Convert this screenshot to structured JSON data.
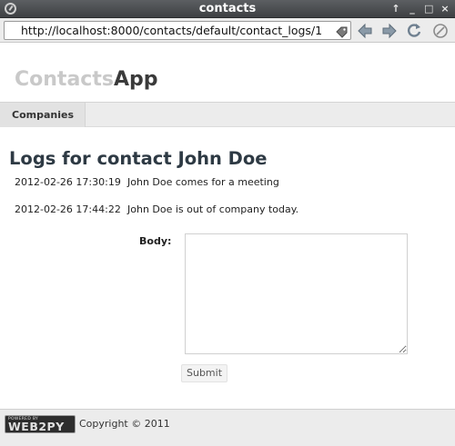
{
  "window": {
    "title": "contacts",
    "controls": [
      "↑",
      "_",
      "□",
      "×"
    ]
  },
  "browser": {
    "url": "http://localhost:8000/contacts/default/contact_logs/1",
    "icons": [
      "tag-icon",
      "back-arrow-icon",
      "forward-arrow-icon",
      "reload-icon",
      "stop-icon"
    ]
  },
  "app": {
    "brand_light": "Contacts",
    "brand_dark": "App"
  },
  "menu": {
    "items": [
      "Companies"
    ]
  },
  "page": {
    "title": "Logs for contact John Doe",
    "logs": [
      {
        "timestamp": "2012-02-26 17:30:19",
        "message": "John Doe comes for a meeting"
      },
      {
        "timestamp": "2012-02-26 17:44:22",
        "message": "John Doe is out of company today."
      }
    ]
  },
  "form": {
    "body_label": "Body:",
    "body_value": "",
    "submit_label": "Submit"
  },
  "footer": {
    "logo_small": "POWERED BY",
    "logo_big": "WEB2PY",
    "copyright": "Copyright © 2011"
  }
}
